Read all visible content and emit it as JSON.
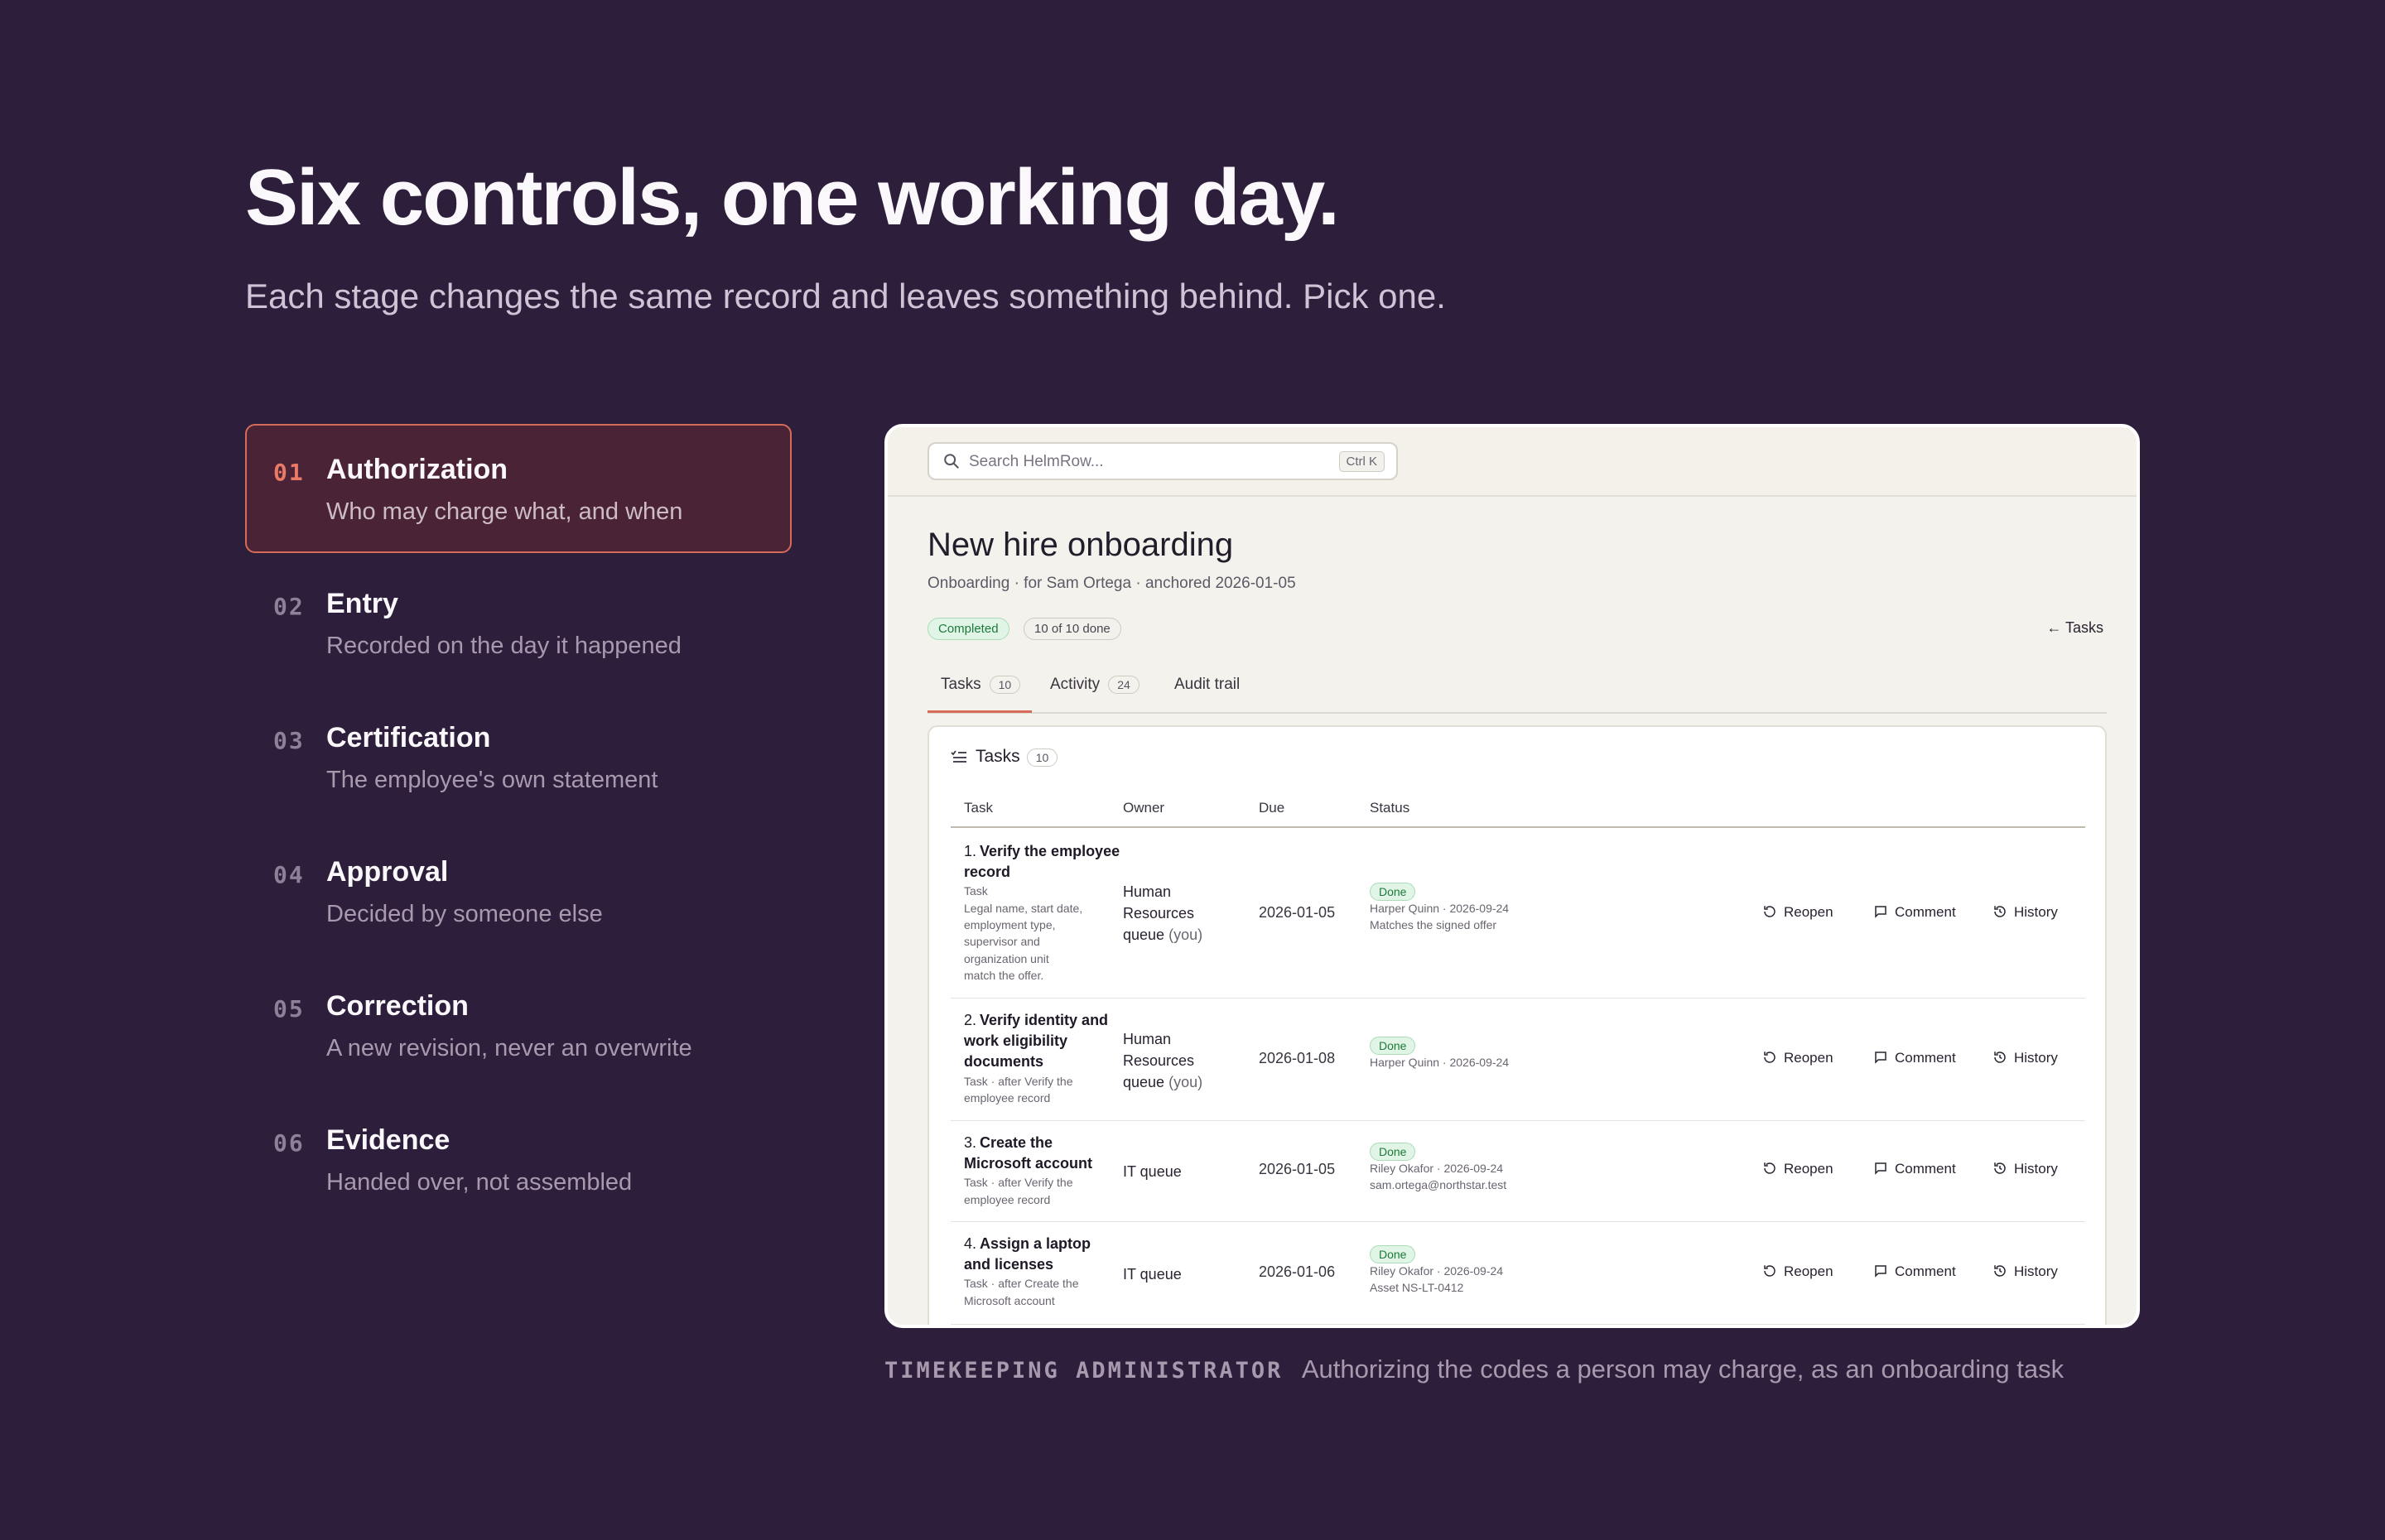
{
  "hero": {
    "title": "Six controls, one working day.",
    "subtitle": "Each stage changes the same record and leaves something behind. Pick one."
  },
  "stages": [
    {
      "num": "01",
      "title": "Authorization",
      "desc": "Who may charge what, and when",
      "active": true
    },
    {
      "num": "02",
      "title": "Entry",
      "desc": "Recorded on the day it happened",
      "active": false
    },
    {
      "num": "03",
      "title": "Certification",
      "desc": "The employee's own statement",
      "active": false
    },
    {
      "num": "04",
      "title": "Approval",
      "desc": "Decided by someone else",
      "active": false
    },
    {
      "num": "05",
      "title": "Correction",
      "desc": "A new revision, never an overwrite",
      "active": false
    },
    {
      "num": "06",
      "title": "Evidence",
      "desc": "Handed over, not assembled",
      "active": false
    }
  ],
  "app": {
    "search_placeholder": "Search HelmRow...",
    "search_shortcut": "Ctrl K",
    "title": "New hire onboarding",
    "subtitle": "Onboarding · for Sam Ortega · anchored 2026-01-05",
    "status_badge": "Completed",
    "progress_badge": "10 of 10 done",
    "back_link": "← Tasks",
    "tabs": [
      {
        "label": "Tasks",
        "count": "10"
      },
      {
        "label": "Activity",
        "count": "24"
      },
      {
        "label": "Audit trail",
        "count": ""
      }
    ],
    "card_title": "Tasks",
    "card_count": "10",
    "columns": {
      "task": "Task",
      "owner": "Owner",
      "due": "Due",
      "status": "Status"
    },
    "actions": {
      "reopen": "Reopen",
      "comment": "Comment",
      "history": "History"
    },
    "rows": [
      {
        "idx": "1.",
        "name": "Verify the employee record",
        "meta": [
          "Task",
          "Legal name, start date,",
          "employment type,",
          "supervisor and",
          "organization unit",
          "match the offer."
        ],
        "owner": [
          "Human",
          "Resources",
          "queue"
        ],
        "owner_you": "(you)",
        "due": "2026-01-05",
        "status": "Done",
        "status_meta": [
          "Harper Quinn · 2026-09-24",
          "Matches the signed offer"
        ]
      },
      {
        "idx": "2.",
        "name": "Verify identity and work eligibility documents",
        "meta": [
          "Task · after Verify the",
          "employee record"
        ],
        "owner": [
          "Human",
          "Resources",
          "queue"
        ],
        "owner_you": "(you)",
        "due": "2026-01-08",
        "status": "Done",
        "status_meta": [
          "Harper Quinn · 2026-09-24"
        ]
      },
      {
        "idx": "3.",
        "name": "Create the Microsoft account",
        "meta": [
          "Task · after Verify the",
          "employee record"
        ],
        "owner": [
          "IT queue"
        ],
        "owner_you": "",
        "due": "2026-01-05",
        "status": "Done",
        "status_meta": [
          "Riley Okafor · 2026-09-24",
          "sam.ortega@northstar.test"
        ]
      },
      {
        "idx": "4.",
        "name": "Assign a laptop and licenses",
        "meta": [
          "Task · after Create the",
          "Microsoft account"
        ],
        "owner": [
          "IT queue"
        ],
        "owner_you": "",
        "due": "2026-01-06",
        "status": "Done",
        "status_meta": [
          "Riley Okafor · 2026-09-24",
          "Asset NS-LT-0412"
        ]
      }
    ]
  },
  "caption": {
    "role": "TIMEKEEPING ADMINISTRATOR",
    "text": "Authorizing the codes a person may charge, as an onboarding task"
  },
  "colors": {
    "background": "#2d1e3b",
    "accent": "#d76b5a",
    "success": "#1d7a3a"
  }
}
